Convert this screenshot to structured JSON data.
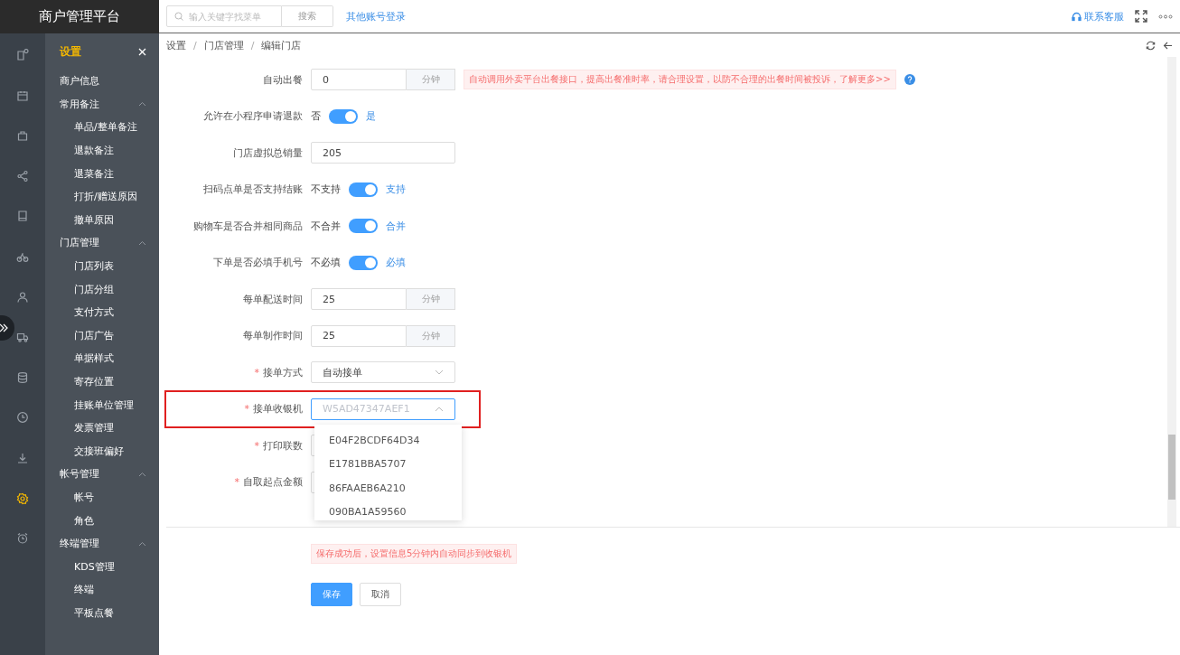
{
  "app": {
    "title": "商户管理平台"
  },
  "topbar": {
    "search": {
      "placeholder": "输入关键字找菜单",
      "button": "搜索"
    },
    "link": "其他账号登录",
    "support": "联系客服"
  },
  "rail": [
    {
      "selected": false
    },
    {
      "selected": false
    },
    {
      "selected": false
    },
    {
      "selected": false
    },
    {
      "selected": false
    },
    {
      "selected": false
    },
    {
      "selected": false
    },
    {
      "selected": false
    },
    {
      "selected": false
    },
    {
      "selected": false
    },
    {
      "selected": false
    },
    {
      "selected": true
    },
    {
      "selected": false
    }
  ],
  "sidebar": {
    "title": "设置",
    "items": [
      {
        "label": "商户信息",
        "selected": false
      },
      {
        "label": "常用备注",
        "expanded": true,
        "children": [
          {
            "label": "单品/整单备注",
            "selected": false
          },
          {
            "label": "退款备注",
            "selected": false
          },
          {
            "label": "退菜备注",
            "selected": false
          },
          {
            "label": "打折/赠送原因",
            "selected": false
          },
          {
            "label": "撤单原因",
            "selected": false
          }
        ]
      },
      {
        "label": "门店管理",
        "expanded": true,
        "children": [
          {
            "label": "门店列表",
            "selected": false
          },
          {
            "label": "门店分组",
            "selected": false
          },
          {
            "label": "支付方式",
            "selected": false
          },
          {
            "label": "门店广告",
            "selected": false
          },
          {
            "label": "单据样式",
            "selected": false
          },
          {
            "label": "寄存位置",
            "selected": false
          },
          {
            "label": "挂账单位管理",
            "selected": false
          },
          {
            "label": "发票管理",
            "selected": false
          },
          {
            "label": "交接班偏好",
            "selected": false
          }
        ]
      },
      {
        "label": "帐号管理",
        "expanded": true,
        "children": [
          {
            "label": "帐号",
            "selected": false
          },
          {
            "label": "角色",
            "selected": false
          }
        ]
      },
      {
        "label": "终端管理",
        "expanded": true,
        "children": [
          {
            "label": "KDS管理",
            "selected": false
          },
          {
            "label": "终端",
            "selected": false
          },
          {
            "label": "平板点餐",
            "selected": false
          }
        ]
      }
    ]
  },
  "breadcrumb": [
    {
      "label": "设置"
    },
    {
      "separator": "/",
      "label": "门店管理"
    },
    {
      "separator": "/",
      "label": "编辑门店"
    }
  ],
  "form": [
    {
      "kind": "unit",
      "label": "自动出餐",
      "value": "0",
      "unit": "分钟",
      "notice": "自动调用外卖平台出餐接口，提高出餐准时率，请合理设置，以防不合理的出餐时间被投诉，了解更多>>"
    },
    {
      "kind": "switch",
      "label": "允许在小程序申请退款",
      "off_label": "否",
      "on_label": "是",
      "on": true
    },
    {
      "kind": "input",
      "label": "门店虚拟总销量",
      "value": "205"
    },
    {
      "kind": "switch",
      "label": "扫码点单是否支持结账",
      "off_label": "不支持",
      "on_label": "支持",
      "on": true
    },
    {
      "kind": "switch",
      "label": "购物车是否合并相同商品",
      "off_label": "不合并",
      "on_label": "合并",
      "on": true
    },
    {
      "kind": "switch",
      "label": "下单是否必填手机号",
      "off_label": "不必填",
      "on_label": "必填",
      "on": true
    },
    {
      "kind": "unit",
      "label": "每单配送时间",
      "value": "25",
      "unit": "分钟"
    },
    {
      "kind": "unit",
      "label": "每单制作时间",
      "value": "25",
      "unit": "分钟"
    },
    {
      "kind": "select",
      "label": "接单方式",
      "required_mark": "*",
      "value": "自动接单",
      "expanded": false
    },
    {
      "kind": "select",
      "label": "接单收银机",
      "required_mark": "*",
      "placeholder": "W5AD47347AEF1",
      "expanded": true,
      "highlighted": true,
      "options": [
        "E04F2BCDF64D34",
        "E1781BBA5707",
        "86FAAEB6A210",
        "090BA1A59560"
      ]
    },
    {
      "kind": "input",
      "label": "打印联数",
      "required_mark": "*"
    },
    {
      "kind": "input",
      "label": "自取起点金额",
      "required_mark": "*"
    }
  ],
  "footer": {
    "notice": "保存成功后，设置信息5分钟内自动同步到收银机",
    "buttons": [
      {
        "label": "保存",
        "kind": "primary"
      },
      {
        "label": "取消",
        "kind": "default"
      }
    ]
  }
}
